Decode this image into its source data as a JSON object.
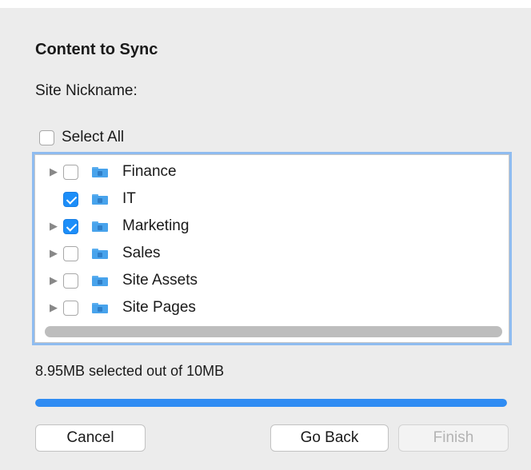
{
  "dialog": {
    "section_title": "Content to Sync",
    "site_nickname_label": "Site Nickname:"
  },
  "select_all": {
    "label": "Select All",
    "checked": false
  },
  "tree": {
    "items": [
      {
        "label": "Finance",
        "checked": false,
        "expandable": true,
        "icon": "folder-icon"
      },
      {
        "label": "IT",
        "checked": true,
        "expandable": false,
        "icon": "folder-icon"
      },
      {
        "label": "Marketing",
        "checked": true,
        "expandable": true,
        "icon": "folder-icon"
      },
      {
        "label": "Sales",
        "checked": false,
        "expandable": true,
        "icon": "folder-icon"
      },
      {
        "label": "Site Assets",
        "checked": false,
        "expandable": true,
        "icon": "folder-icon"
      },
      {
        "label": "Site Pages",
        "checked": false,
        "expandable": true,
        "icon": "folder-icon"
      }
    ]
  },
  "status": {
    "text": "8.95MB selected out of 10MB",
    "progress_fraction": 1.0
  },
  "buttons": {
    "cancel": "Cancel",
    "go_back": "Go Back",
    "finish": "Finish",
    "finish_disabled": true
  },
  "colors": {
    "accent": "#1c8ef9",
    "folder": "#48a3ec",
    "focus_ring": "#8fbcf0"
  }
}
